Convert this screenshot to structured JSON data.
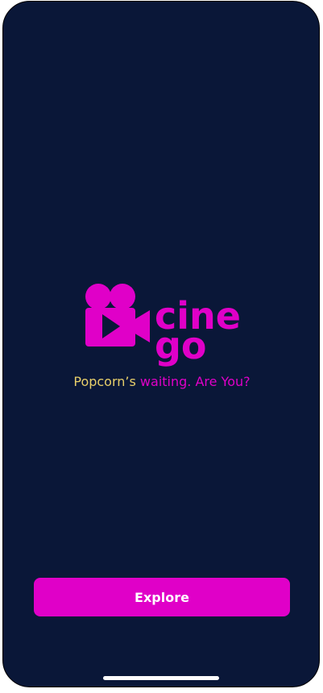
{
  "app": {
    "logo_icon": "camera-icon",
    "logo_word_top": "cine",
    "logo_word_bottom": "go"
  },
  "tagline": {
    "part1": "Popcorn’s ",
    "part2": "waiting. Are You?"
  },
  "actions": {
    "explore_label": "Explore"
  },
  "colors": {
    "background": "#0a1738",
    "brand": "#e000c8",
    "accent": "#e8cf6a",
    "button_text": "#ffffff"
  }
}
